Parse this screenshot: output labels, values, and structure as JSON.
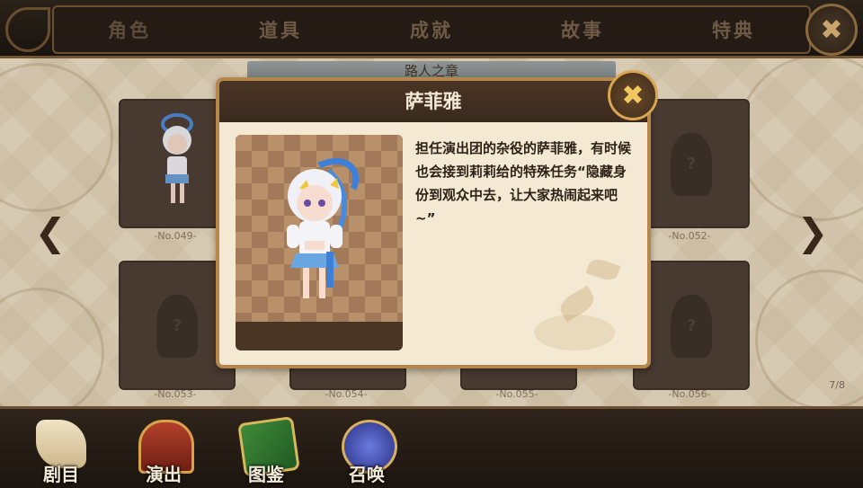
{
  "tabs": [
    "角色",
    "道具",
    "成就",
    "故事",
    "特典"
  ],
  "top_close_glyph": "✖",
  "section_title": "路人之章",
  "slots": [
    {
      "label": "-No.049-",
      "unlocked": true
    },
    {
      "label": "-No.052-",
      "unlocked": false
    },
    {
      "label": "-No.053-",
      "unlocked": false
    },
    {
      "label": "-No.054-",
      "unlocked": false
    },
    {
      "label": "-No.055-",
      "unlocked": false
    },
    {
      "label": "-No.056-",
      "unlocked": false
    }
  ],
  "page_counter": "7/8",
  "arrows": {
    "left": "❮",
    "right": "❯"
  },
  "modal": {
    "title": "萨菲雅",
    "close_glyph": "✖",
    "description": "担任演出团的杂役的萨菲雅，有时候也会接到莉莉给的特殊任务“隐藏身份到观众中去，让大家热闹起来吧~”"
  },
  "bottom_nav": [
    {
      "label": "剧目",
      "icon": "scroll-wings-icon"
    },
    {
      "label": "演出",
      "icon": "stage-curtain-icon"
    },
    {
      "label": "图鉴",
      "icon": "green-book-icon"
    },
    {
      "label": "召唤",
      "icon": "winged-orb-icon"
    }
  ],
  "colors": {
    "accent": "#b5874d",
    "dark": "#2e241b",
    "panel": "#f4e9d2"
  }
}
